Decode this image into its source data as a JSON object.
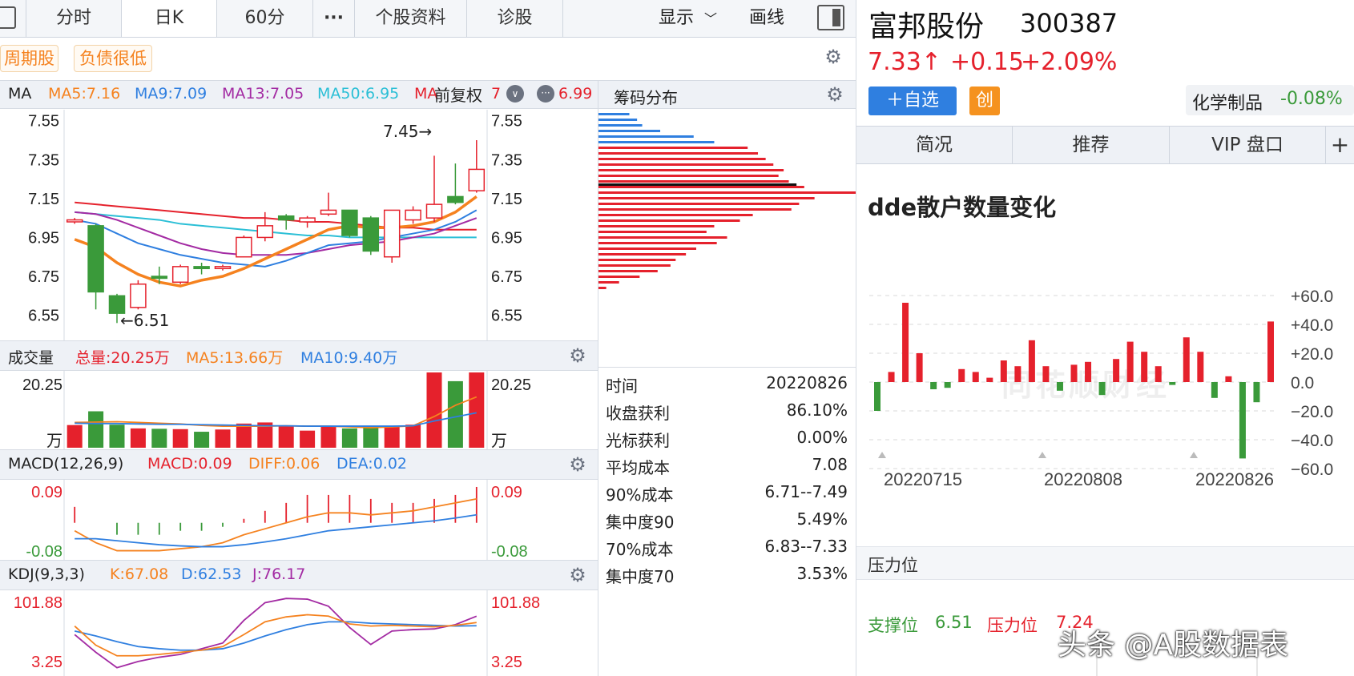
{
  "toolbar": {
    "left_icon": "panel-toggle-icon",
    "tabs": [
      "分时",
      "日K",
      "60分",
      "···",
      "个股资料",
      "诊股"
    ],
    "display_label": "显示",
    "draw_label": "画线",
    "right_icon": "sidebar-toggle-icon"
  },
  "tags": [
    "周期股",
    "负债很低"
  ],
  "kline": {
    "legend_name": "MA",
    "ma5": "MA5:7.16",
    "ma9": "MA9:7.09",
    "ma13": "MA13:7.05",
    "ma50": "MA50:6.95",
    "overlay_partial_1": "MA",
    "overlay_partial_2": "7",
    "ma_last": "6.99",
    "fuquan": "前复权",
    "y_labels": [
      "7.55",
      "7.35",
      "7.15",
      "6.95",
      "6.75",
      "6.55"
    ],
    "high_mark": "7.45→",
    "low_mark": "←6.51",
    "candles": [
      {
        "o": 7.03,
        "c": 7.04,
        "h": 7.05,
        "l": 7.02
      },
      {
        "o": 7.01,
        "c": 6.67,
        "h": 7.02,
        "l": 6.58
      },
      {
        "o": 6.65,
        "c": 6.56,
        "h": 6.66,
        "l": 6.51
      },
      {
        "o": 6.59,
        "c": 6.71,
        "h": 6.73,
        "l": 6.58
      },
      {
        "o": 6.75,
        "c": 6.74,
        "h": 6.8,
        "l": 6.71
      },
      {
        "o": 6.72,
        "c": 6.8,
        "h": 6.81,
        "l": 6.71
      },
      {
        "o": 6.8,
        "c": 6.79,
        "h": 6.82,
        "l": 6.76
      },
      {
        "o": 6.79,
        "c": 6.8,
        "h": 6.81,
        "l": 6.78
      },
      {
        "o": 6.85,
        "c": 6.95,
        "h": 6.96,
        "l": 6.85
      },
      {
        "o": 6.95,
        "c": 7.01,
        "h": 7.08,
        "l": 6.93
      },
      {
        "o": 7.06,
        "c": 7.04,
        "h": 7.07,
        "l": 6.99
      },
      {
        "o": 7.03,
        "c": 7.05,
        "h": 7.06,
        "l": 7.0
      },
      {
        "o": 7.07,
        "c": 7.09,
        "h": 7.18,
        "l": 7.06
      },
      {
        "o": 7.09,
        "c": 6.96,
        "h": 7.09,
        "l": 6.95
      },
      {
        "o": 7.05,
        "c": 6.88,
        "h": 7.06,
        "l": 6.86
      },
      {
        "o": 6.85,
        "c": 7.09,
        "h": 7.09,
        "l": 6.82
      },
      {
        "o": 7.04,
        "c": 7.09,
        "h": 7.11,
        "l": 7.02
      },
      {
        "o": 7.05,
        "c": 7.12,
        "h": 7.37,
        "l": 7.03
      },
      {
        "o": 7.16,
        "c": 7.13,
        "h": 7.33,
        "l": 7.12
      },
      {
        "o": 7.19,
        "c": 7.3,
        "h": 7.45,
        "l": 7.18
      }
    ],
    "ma_series": {
      "ma5": [
        6.94,
        6.9,
        6.82,
        6.76,
        6.72,
        6.7,
        6.73,
        6.75,
        6.79,
        6.84,
        6.89,
        6.94,
        6.99,
        7.01,
        7.0,
        7.0,
        7.01,
        7.03,
        7.08,
        7.16
      ],
      "ma9": [
        7.04,
        7.02,
        6.97,
        6.92,
        6.89,
        6.86,
        6.84,
        6.82,
        6.81,
        6.8,
        6.83,
        6.87,
        6.91,
        6.92,
        6.93,
        6.95,
        6.97,
        6.99,
        7.03,
        7.09
      ],
      "ma13": [
        7.08,
        7.07,
        7.04,
        7.0,
        6.96,
        6.92,
        6.89,
        6.87,
        6.86,
        6.86,
        6.86,
        6.87,
        6.89,
        6.91,
        6.92,
        6.93,
        6.95,
        6.97,
        7.01,
        7.05
      ],
      "ma50": [
        7.08,
        7.07,
        7.06,
        7.05,
        7.04,
        7.02,
        7.01,
        7.0,
        6.99,
        6.98,
        6.97,
        6.96,
        6.96,
        6.95,
        6.95,
        6.95,
        6.95,
        6.95,
        6.95,
        6.95
      ],
      "ma_red": [
        7.13,
        7.12,
        7.11,
        7.1,
        7.09,
        7.08,
        7.07,
        7.06,
        7.05,
        7.05,
        7.04,
        7.03,
        7.03,
        7.02,
        7.01,
        7.0,
        7.0,
        6.99,
        6.99,
        6.99
      ]
    }
  },
  "volume": {
    "label": "成交量",
    "total": "总量:20.25万",
    "ma5": "MA5:13.66万",
    "ma10": "MA10:9.40万",
    "y_top": "20.25",
    "unit": "万",
    "bars": [
      6.1,
      9.8,
      6.2,
      5.2,
      5.1,
      5.0,
      4.3,
      4.9,
      6.5,
      6.8,
      5.8,
      4.6,
      5.6,
      5.2,
      5.9,
      5.7,
      6.2,
      20.25,
      17.9,
      20.25
    ],
    "bar_up": [
      true,
      false,
      false,
      true,
      false,
      true,
      false,
      true,
      true,
      true,
      true,
      true,
      true,
      false,
      false,
      true,
      true,
      true,
      false,
      true
    ],
    "ma5_line": [
      6.8,
      6.9,
      7.0,
      6.8,
      6.6,
      6.4,
      6.0,
      5.8,
      5.8,
      5.8,
      5.9,
      5.8,
      5.8,
      5.6,
      5.4,
      5.6,
      5.9,
      8.4,
      11.4,
      13.66
    ],
    "ma10_line": [
      6.6,
      6.5,
      6.5,
      6.4,
      6.3,
      6.3,
      6.2,
      6.1,
      6.0,
      5.9,
      5.9,
      5.8,
      5.8,
      5.8,
      5.8,
      5.8,
      5.9,
      7.2,
      8.3,
      9.4
    ]
  },
  "macd": {
    "label": "MACD(12,26,9)",
    "macd": "MACD:0.09",
    "diff": "DIFF:0.06",
    "dea": "DEA:0.02",
    "y_top": "0.09",
    "y_bottom": "-0.08",
    "hist": [
      0.04,
      0.0,
      -0.03,
      -0.03,
      -0.03,
      -0.02,
      -0.02,
      -0.01,
      0.01,
      0.03,
      0.05,
      0.07,
      0.07,
      0.07,
      0.06,
      0.05,
      0.05,
      0.06,
      0.07,
      0.09
    ],
    "diff_line": [
      -0.02,
      -0.05,
      -0.07,
      -0.07,
      -0.07,
      -0.065,
      -0.06,
      -0.05,
      -0.03,
      -0.015,
      0.0,
      0.015,
      0.025,
      0.025,
      0.02,
      0.025,
      0.03,
      0.04,
      0.05,
      0.06
    ],
    "dea_line": [
      -0.04,
      -0.04,
      -0.045,
      -0.05,
      -0.055,
      -0.058,
      -0.06,
      -0.06,
      -0.055,
      -0.048,
      -0.04,
      -0.03,
      -0.02,
      -0.015,
      -0.01,
      -0.005,
      0.0,
      0.005,
      0.012,
      0.02
    ]
  },
  "kdj": {
    "label": "KDJ(9,3,3)",
    "k": "K:67.08",
    "d": "D:62.53",
    "j": "J:76.17",
    "y_top": "101.88",
    "y_bottom": "3.25",
    "k_line": [
      62,
      35,
      20,
      20,
      22,
      25,
      28,
      33,
      50,
      68,
      75,
      78,
      76,
      65,
      62,
      63,
      62,
      61,
      63,
      67
    ],
    "d_line": [
      55,
      48,
      40,
      33,
      30,
      28,
      28,
      30,
      38,
      48,
      57,
      64,
      68,
      68,
      66,
      65,
      64,
      63,
      62,
      62.5
    ],
    "j_line": [
      50,
      25,
      3.25,
      12,
      18,
      22,
      30,
      38,
      70,
      95,
      101,
      100,
      90,
      60,
      36,
      55,
      57,
      58,
      64,
      76
    ]
  },
  "chips": {
    "title": "筹码分布",
    "rows": [
      {
        "label": "时间",
        "value": "20220826"
      },
      {
        "label": "收盘获利",
        "value": "86.10%"
      },
      {
        "label": "光标获利",
        "value": "0.00%"
      },
      {
        "label": "平均成本",
        "value": "7.08"
      },
      {
        "label": "90%成本",
        "value": "6.71--7.49"
      },
      {
        "label": "集中度90",
        "value": "5.49%"
      },
      {
        "label": "70%成本",
        "value": "6.83--7.33"
      },
      {
        "label": "集中度70",
        "value": "3.53%"
      }
    ],
    "blue_bars": [
      0.12,
      0.15,
      0.17,
      0.24,
      0.37,
      0.45
    ],
    "red_bars": [
      0.58,
      0.62,
      0.65,
      0.68,
      0.72,
      0.7,
      0.74,
      0.8,
      1.0,
      0.84,
      0.78,
      0.75,
      0.6,
      0.55,
      0.45,
      0.42,
      0.5,
      0.46,
      0.38,
      0.34,
      0.3,
      0.28,
      0.23,
      0.16,
      0.08,
      0.03
    ],
    "avg_cost_index": 7
  },
  "stock": {
    "name": "富邦股份",
    "code": "300387",
    "price": "7.33↑",
    "change": "+0.15",
    "change_pct": "+2.09%",
    "add_button": "＋自选",
    "board_badge": "创",
    "industry": "化学制品",
    "industry_change": "-0.08%"
  },
  "right_tabs": [
    "简况",
    "推荐",
    "VIP 盘口",
    "+"
  ],
  "dde": {
    "title": "dde散户数量变化",
    "y_labels": [
      "+60.0",
      "+40.0",
      "+20.0",
      "0.0",
      "−20.0",
      "−40.0",
      "−60.0"
    ],
    "x_labels": [
      "20220715",
      "20220808",
      "20220826"
    ],
    "watermark": "同花顺财经",
    "values": [
      -20,
      7,
      55,
      20,
      -5,
      -4,
      9,
      7,
      3,
      15,
      11,
      29,
      11,
      -6,
      12,
      14,
      -9,
      16,
      28,
      21,
      11,
      -2,
      31,
      21,
      -11,
      4,
      -53,
      -14,
      42
    ]
  },
  "pressure": {
    "title": "压力位",
    "support_label": "支撑位",
    "support_value": "6.51",
    "pressure_label": "压力位",
    "pressure_value": "7.24"
  },
  "watermark_text": "头条 @A股数据表",
  "colors": {
    "up": "#e5212c",
    "down": "#3a9a3a",
    "ma5": "#f5821f",
    "ma9": "#2f7fe0",
    "ma13": "#a32ba3",
    "ma50": "#2bbfd6",
    "accent_blue": "#2f7fe0"
  }
}
